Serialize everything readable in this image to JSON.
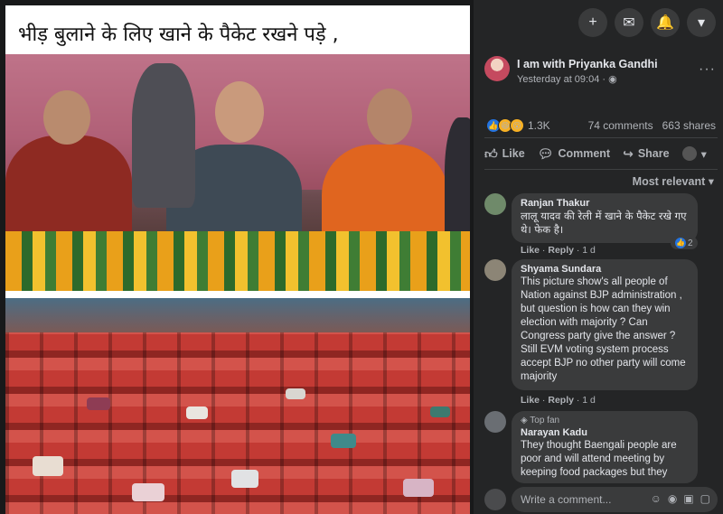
{
  "post_image": {
    "caption": "भीड़ बुलाने के लिए खाने के पैकेट रखने पड़े ,"
  },
  "topbar": {
    "buttons": [
      {
        "icon": "plus-icon",
        "glyph": "+"
      },
      {
        "icon": "messenger-icon",
        "glyph": "✉"
      },
      {
        "icon": "bell-icon",
        "glyph": "🔔"
      },
      {
        "icon": "chevron-down-icon",
        "glyph": "▾"
      }
    ]
  },
  "page": {
    "name": "I am with Priyanka Gandhi",
    "time": "Yesterday at 09:04 · ◉",
    "more": "···"
  },
  "reactions": {
    "count": "1.3K",
    "comments": "74 comments",
    "shares": "663 shares",
    "icons": [
      "like-reaction-icon",
      "haha-reaction-icon",
      "wow-reaction-icon"
    ]
  },
  "actions": {
    "like": "Like",
    "comment": "Comment",
    "share": "Share"
  },
  "sort_label": "Most relevant ▾",
  "comments": [
    {
      "name": "Ranjan Thakur",
      "text": "लालू यादव की रेली में खाने के पैकेट रखे गए थे। फेक है।",
      "meta_like": "Like",
      "meta_reply": "Reply",
      "meta_time": "1 d",
      "likes": "2",
      "avatar_color": "#6f8a6a"
    },
    {
      "name": "Shyama Sundara",
      "text": "This picture show's all people of Nation against BJP administration , but question is how can they win election with majority ? Can Congress party give the answer ? Still EVM voting system process accept BJP no other party will come majority",
      "meta_like": "Like",
      "meta_reply": "Reply",
      "meta_time": "1 d",
      "avatar_color": "#8c8576"
    },
    {
      "badge": "Top fan",
      "name": "Narayan Kadu",
      "text": "They thought Baengali people are poor and will attend meeting by keeping food packages but they",
      "avatar_color": "#6a6e73"
    }
  ],
  "composer": {
    "placeholder": "Write a comment...",
    "icons": [
      "emoji-icon",
      "camera-icon",
      "gif-icon",
      "sticker-icon"
    ]
  }
}
